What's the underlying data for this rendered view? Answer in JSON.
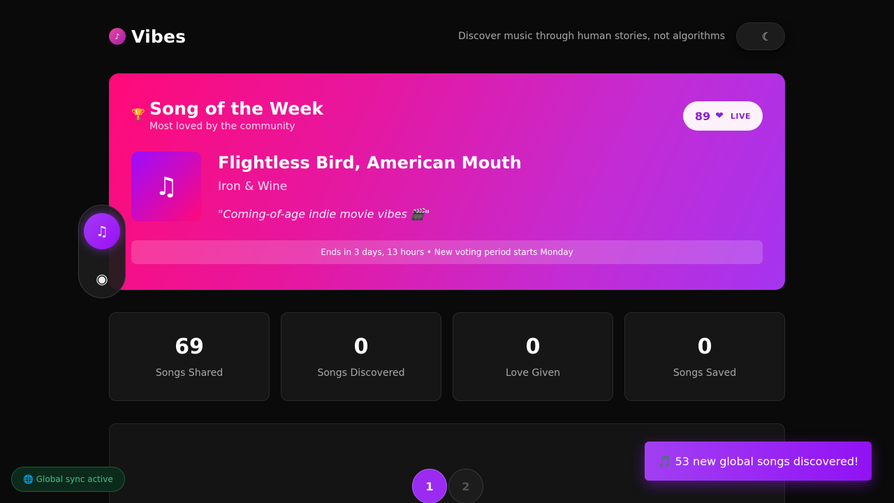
{
  "app": {
    "brand_icon": "music-note-icon",
    "brand_glyph": "♪",
    "name": "Vibes",
    "tagline": "Discover music through human stories, not algorithms",
    "theme_toggle_glyph": "☾"
  },
  "song_of_week": {
    "trophy_glyph": "🏆",
    "title": "Song of the Week",
    "subtitle": "Most loved by the community",
    "love_count": "89",
    "love_heart": "❤",
    "live_label": "LIVE",
    "art_glyph": "♫",
    "song_title": "Flightless Bird, American Mouth",
    "artist": "Iron & Wine",
    "quote": "\"Coming-of-age indie movie vibes 🎬\"",
    "ends_text": "Ends in 3 days, 13 hours • New voting period starts Monday"
  },
  "side_nav": {
    "items": [
      {
        "icon": "music-icon",
        "glyph": "♫",
        "active": true
      },
      {
        "icon": "record-icon",
        "glyph": "◉",
        "active": false
      }
    ]
  },
  "stats": [
    {
      "value": "69",
      "label": "Songs Shared"
    },
    {
      "value": "0",
      "label": "Songs Discovered"
    },
    {
      "value": "0",
      "label": "Love Given"
    },
    {
      "value": "0",
      "label": "Songs Saved"
    }
  ],
  "pager": {
    "pages": [
      "1",
      "2"
    ],
    "current": "1"
  },
  "sync": {
    "icon": "globe-icon",
    "text": "🌐 Global sync active"
  },
  "toast": {
    "text": "🎵 53 new global songs discovered!"
  },
  "colors": {
    "accent": "#9b2bf0",
    "hero_start": "#ff0a78",
    "hero_end": "#a534f0",
    "sync_green": "#34c77e"
  }
}
